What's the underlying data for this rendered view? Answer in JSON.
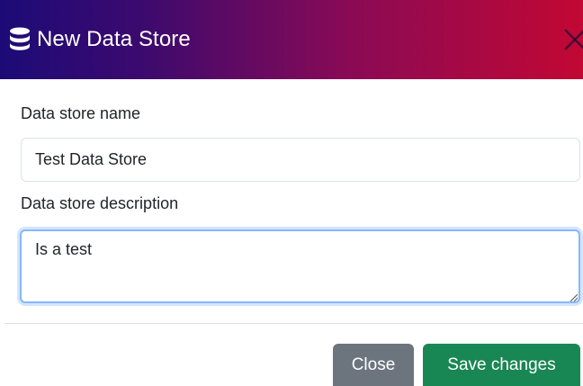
{
  "dialog": {
    "title": "New Data Store",
    "icons": {
      "title_icon": "database-icon",
      "close_icon": "close-icon"
    },
    "colors": {
      "header_gradient_start": "#1c0b77",
      "header_gradient_end": "#c20833",
      "close_button": "#6c757d",
      "save_button": "#198754",
      "focus_border": "#86b7fe"
    }
  },
  "form": {
    "name_label": "Data store name",
    "name_value": "Test Data Store",
    "description_label": "Data store description",
    "description_value": "Is a test"
  },
  "footer": {
    "close_label": "Close",
    "save_label": "Save changes"
  }
}
